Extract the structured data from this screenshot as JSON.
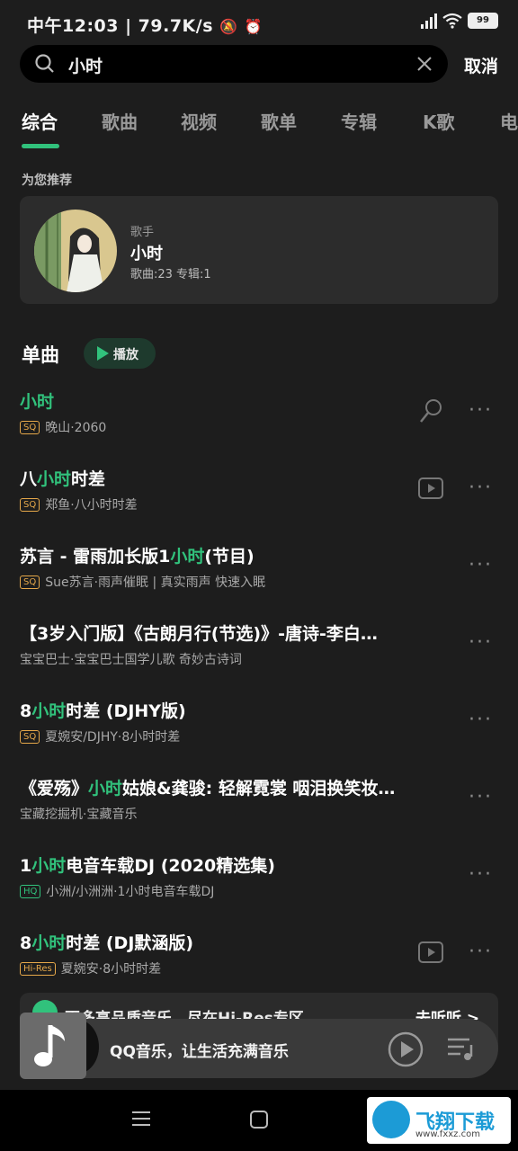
{
  "status_bar": {
    "time": "中午12:03",
    "speed": "79.7K/s",
    "battery": "99"
  },
  "search": {
    "query": "小时",
    "cancel_label": "取消"
  },
  "tabs": [
    "综合",
    "歌曲",
    "视频",
    "歌单",
    "专辑",
    "K歌",
    "电"
  ],
  "recommend": {
    "section_title": "为您推荐",
    "type": "歌手",
    "name": "小时",
    "stats": "歌曲:23 专辑:1"
  },
  "singles": {
    "title": "单曲",
    "play_label": "播放",
    "songs": [
      {
        "pre": "",
        "hl": "小时",
        "post": "",
        "badge": "SQ",
        "meta": "晚山·2060",
        "action": "mic"
      },
      {
        "pre": "八",
        "hl": "小时",
        "post": "时差",
        "badge": "SQ",
        "meta": "郑鱼·八小时时差",
        "action": "video"
      },
      {
        "pre": "苏言 - 雷雨加长版1",
        "hl": "小时",
        "post": "(节目)",
        "badge": "SQ",
        "meta": "Sue苏言·雨声催眠 | 真实雨声 快速入眠",
        "action": ""
      },
      {
        "pre": "【3岁入门版】《古朗月行(节选)》-唐诗-李白…",
        "hl": "",
        "post": "",
        "badge": "",
        "meta": "宝宝巴士·宝宝巴士国学儿歌 奇妙古诗词",
        "action": ""
      },
      {
        "pre": "8",
        "hl": "小时",
        "post": "时差 (DJHY版)",
        "badge": "SQ",
        "meta": "夏婉安/DJHY·8小时时差",
        "action": ""
      },
      {
        "pre": "《爱殇》",
        "hl": "小时",
        "post": "姑娘&龚骏: 轻解霓裳 咽泪换笑妆…",
        "badge": "",
        "meta": "宝藏挖掘机·宝藏音乐",
        "action": ""
      },
      {
        "pre": "1",
        "hl": "小时",
        "post": "电音车载DJ (2020精选集)",
        "badge": "HQ",
        "meta": "小洲/小洲洲·1小时电音车载DJ",
        "action": ""
      },
      {
        "pre": "8",
        "hl": "小时",
        "post": "时差 (DJ默涵版)",
        "badge": "Hi-Res",
        "meta": "夏婉安·8小时时差",
        "action": "video"
      }
    ]
  },
  "promo": {
    "text": "更多高品质音乐，尽在Hi-Res专区",
    "link": "去听听 >"
  },
  "player": {
    "text": "QQ音乐，让生活充满音乐"
  },
  "watermark": {
    "text": "飞翔下载",
    "url": "www.fxxz.com"
  }
}
